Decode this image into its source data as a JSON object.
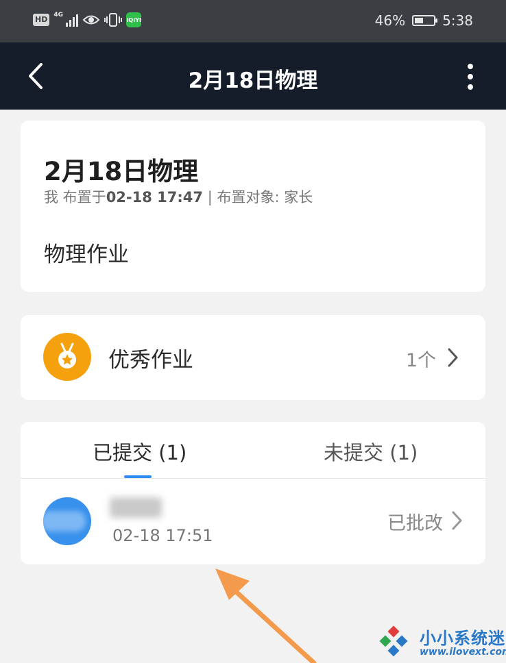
{
  "status_bar": {
    "hd": "HD",
    "network": "4G",
    "app_badge": "iQIYI",
    "battery_text": "46%",
    "battery_level": 0.46,
    "time": "5:38"
  },
  "nav": {
    "title": "2月18日物理"
  },
  "homework": {
    "title": "2月18日物理",
    "meta_prefix": "我 布置于",
    "meta_time": "02-18 17:47",
    "meta_suffix": " | 布置对象: 家长",
    "description": "物理作业"
  },
  "excellent": {
    "label": "优秀作业",
    "count": "1个"
  },
  "submissions": {
    "tabs": [
      {
        "label": "已提交 (1)",
        "active": true
      },
      {
        "label": "未提交 (1)",
        "active": false
      }
    ],
    "items": [
      {
        "time": "02-18 17:51",
        "status": "已批改"
      }
    ]
  },
  "watermark": {
    "name": "小小系统迷",
    "url": "www.ilovext.com"
  },
  "colors": {
    "accent_blue": "#2d8ef3",
    "medal_orange": "#f5a00d",
    "nav_bg": "#141d29",
    "arrow_orange": "#f39a4d"
  }
}
